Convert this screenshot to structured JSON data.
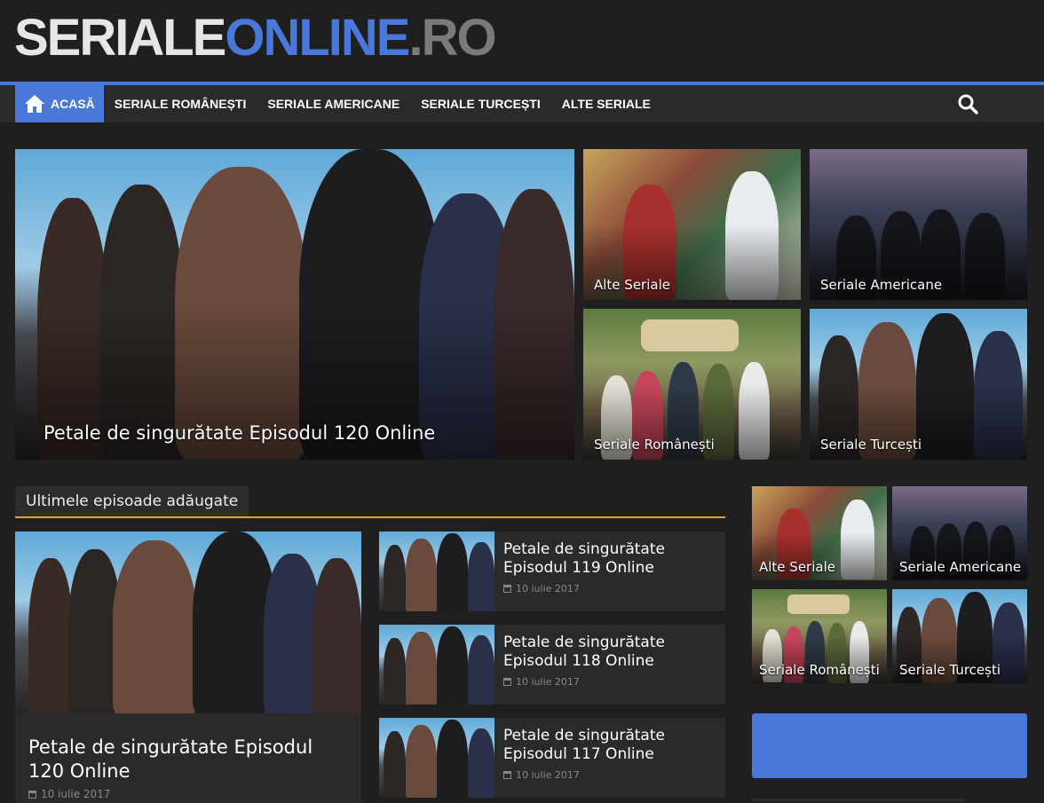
{
  "logo": {
    "part1": "SERIALE",
    "part2": "ONLINE",
    "part3": ".RO"
  },
  "nav": {
    "home": "ACASĂ",
    "items": [
      "SERIALE ROMÂNEȘTI",
      "SERIALE AMERICANE",
      "SERIALE TURCEȘTI",
      "ALTE SERIALE"
    ]
  },
  "featured": {
    "main": "Petale de singurătate Episodul 120 Online",
    "tiles": [
      "Alte Seriale",
      "Seriale Americane",
      "Seriale Românești",
      "Seriale Turcești"
    ]
  },
  "section": {
    "title": "Ultimele episoade adăugate"
  },
  "latest": {
    "big": {
      "title": "Petale de singurătate Episodul 120 Online",
      "date": "10 iulie 2017"
    },
    "items": [
      {
        "title": "Petale de singurătate Episodul 119 Online",
        "date": "10 iulie 2017"
      },
      {
        "title": "Petale de singurătate Episodul 118 Online",
        "date": "10 iulie 2017"
      },
      {
        "title": "Petale de singurătate Episodul 117 Online",
        "date": "10 iulie 2017"
      }
    ]
  },
  "sidebar": {
    "tiles": [
      "Alte Seriale",
      "Seriale Americane",
      "Seriale Românești",
      "Seriale Turcești"
    ]
  },
  "colors": {
    "accent": "#4a78d8",
    "section_underline": "#f0a020",
    "background": "#1f1f1f"
  },
  "icons": {
    "home": "home-icon",
    "search": "search-icon",
    "date": "calendar-icon"
  }
}
